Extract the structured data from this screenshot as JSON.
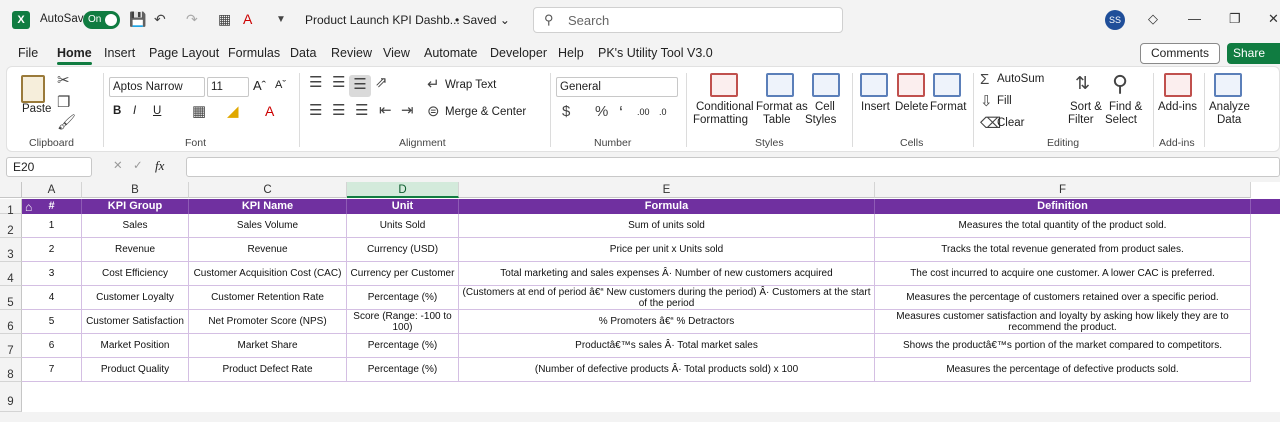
{
  "titlebar": {
    "app_icon": "X",
    "autosave_label": "AutoSave",
    "autosave_state": "On",
    "doc_title": "Product Launch KPI Dashb...",
    "saved_label": "Saved",
    "search_placeholder": "Search",
    "user_initials": "SS"
  },
  "menu": [
    "File",
    "Home",
    "Insert",
    "Page Layout",
    "Formulas",
    "Data",
    "Review",
    "View",
    "Automate",
    "Developer",
    "Help",
    "PK's Utility Tool V3.0"
  ],
  "menu_actions": {
    "comments": "Comments",
    "share": "Share"
  },
  "ribbon": {
    "clipboard": {
      "label": "Clipboard",
      "paste": "Paste"
    },
    "font": {
      "label": "Font",
      "font_name": "Aptos Narrow",
      "font_size": "11"
    },
    "alignment": {
      "label": "Alignment",
      "wrap_text": "Wrap Text",
      "merge_center": "Merge & Center"
    },
    "number": {
      "label": "Number",
      "format": "General"
    },
    "styles": {
      "label": "Styles",
      "conditional_1": "Conditional",
      "conditional_2": "Formatting",
      "format_as_1": "Format as",
      "format_as_2": "Table",
      "cell_1": "Cell",
      "cell_2": "Styles"
    },
    "cells": {
      "label": "Cells",
      "insert": "Insert",
      "delete": "Delete",
      "format": "Format"
    },
    "editing": {
      "label": "Editing",
      "autosum": "AutoSum",
      "fill": "Fill",
      "clear": "Clear",
      "sort_1": "Sort &",
      "sort_2": "Filter",
      "find_1": "Find &",
      "find_2": "Select"
    },
    "addins": {
      "label": "Add-ins",
      "addins": "Add-ins"
    },
    "analyze": {
      "analyze_1": "Analyze",
      "analyze_2": "Data"
    }
  },
  "formula_bar": {
    "name_box": "E20",
    "fx": "fx",
    "value": ""
  },
  "sheet": {
    "columns": [
      "A",
      "B",
      "C",
      "D",
      "E",
      "F"
    ],
    "rows": [
      "1",
      "2",
      "3",
      "4",
      "5",
      "6",
      "7",
      "8",
      "9"
    ],
    "headers": [
      "#",
      "KPI Group",
      "KPI Name",
      "Unit",
      "Formula",
      "Definition"
    ],
    "data": [
      [
        "1",
        "Sales",
        "Sales Volume",
        "Units Sold",
        "Sum of units sold",
        "Measures the total quantity of the product sold."
      ],
      [
        "2",
        "Revenue",
        "Revenue",
        "Currency (USD)",
        "Price per unit x Units sold",
        "Tracks the total revenue generated from product sales."
      ],
      [
        "3",
        "Cost Efficiency",
        "Customer Acquisition Cost (CAC)",
        "Currency per Customer",
        "Total marketing and sales expenses Â· Number of new customers acquired",
        "The cost incurred to acquire one customer. A lower CAC is preferred."
      ],
      [
        "4",
        "Customer Loyalty",
        "Customer Retention Rate",
        "Percentage (%)",
        "(Customers at end of period â€“ New customers during the period) Â· Customers at the start of the period",
        "Measures the percentage of customers retained over a specific period."
      ],
      [
        "5",
        "Customer Satisfaction",
        "Net Promoter Score (NPS)",
        "Score (Range: -100 to 100)",
        "% Promoters â€“ % Detractors",
        "Measures customer satisfaction and loyalty by asking how likely they are to recommend the product."
      ],
      [
        "6",
        "Market Position",
        "Market Share",
        "Percentage (%)",
        "Productâ€™s sales Â· Total market sales",
        "Shows the productâ€™s portion of the market compared to competitors."
      ],
      [
        "7",
        "Product Quality",
        "Product Defect Rate",
        "Percentage (%)",
        "(Number of defective products Â· Total products sold) x 100",
        "Measures the percentage of defective products sold."
      ]
    ]
  },
  "colors": {
    "header_purple": "#7030a0",
    "excel_green": "#107c41"
  }
}
